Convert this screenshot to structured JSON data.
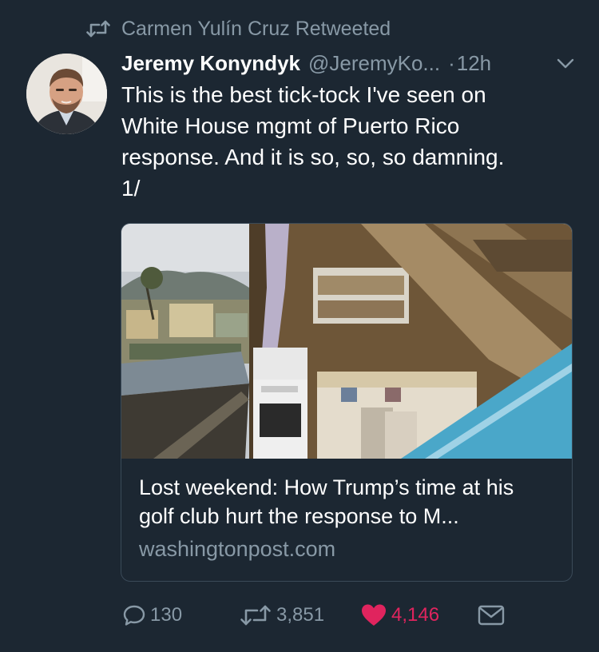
{
  "retweet": {
    "icon": "retweet-icon",
    "label": "Carmen Yulín Cruz Retweeted"
  },
  "tweet": {
    "author_name": "Jeremy Konyndyk",
    "author_handle": "@JeremyKo...",
    "separator": "·",
    "time": "12h",
    "text": "This is the best tick-tock I've seen on\nWhite House mgmt of Puerto Rico\nresponse. And it is so, so, so damning.\n1/"
  },
  "card": {
    "title": "Lost weekend: How Trump’s time at his golf club hurt the response to M...",
    "domain": "washingtonpost.com"
  },
  "actions": {
    "reply_count": "130",
    "retweet_count": "3,851",
    "like_count": "4,146"
  },
  "colors": {
    "background": "#1c2732",
    "secondary_text": "#8899a6",
    "like": "#e0245e",
    "card_border": "#3a4a58"
  }
}
